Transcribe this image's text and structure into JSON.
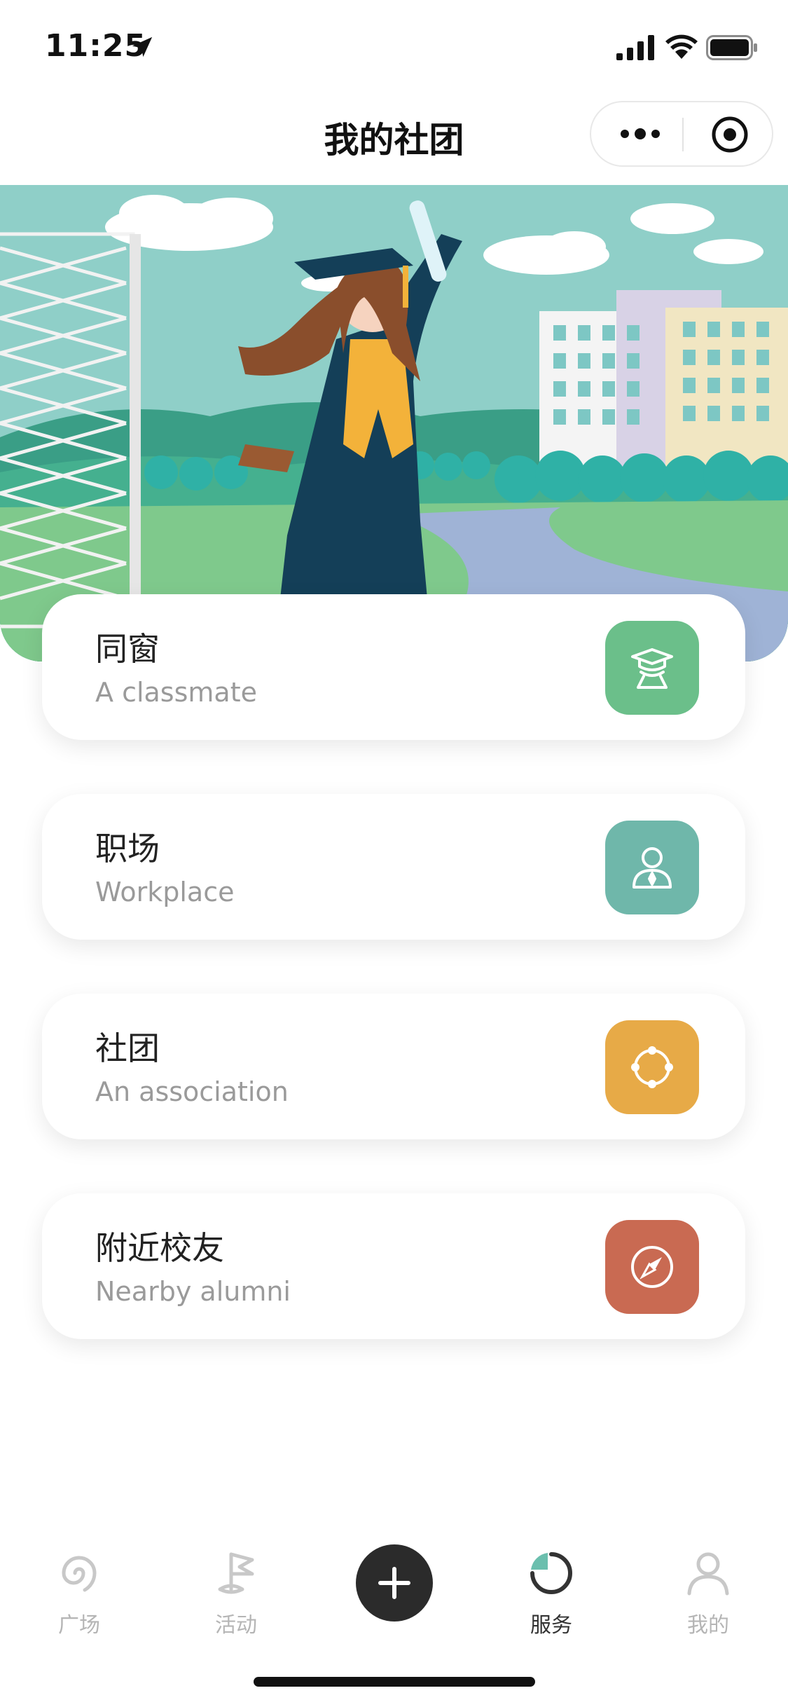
{
  "status_bar": {
    "time": "11:25"
  },
  "nav": {
    "title": "我的社团"
  },
  "cards": [
    {
      "title": "同窗",
      "subtitle": "A classmate",
      "icon": "graduate-icon",
      "color": "#6bbf8a"
    },
    {
      "title": "职场",
      "subtitle": "Workplace",
      "icon": "worker-icon",
      "color": "#6fb7aa"
    },
    {
      "title": "社团",
      "subtitle": "An association",
      "icon": "group-circle-icon",
      "color": "#e7aa47"
    },
    {
      "title": "附近校友",
      "subtitle": "Nearby alumni",
      "icon": "compass-icon",
      "color": "#c96a52"
    }
  ],
  "tabbar": {
    "items": [
      {
        "label": "广场",
        "icon": "spiral-icon"
      },
      {
        "label": "活动",
        "icon": "flag-icon"
      },
      {
        "label": "服务",
        "icon": "pie-service-icon",
        "active": true
      },
      {
        "label": "我的",
        "icon": "person-icon"
      }
    ],
    "add_icon": "plus-icon"
  },
  "colors": {
    "accent_green": "#6bbf8a",
    "accent_teal": "#6fb7aa",
    "accent_orange": "#e7aa47",
    "accent_red": "#c96a52",
    "tab_active": "#333333",
    "tab_inactive": "#b5b5b5"
  }
}
